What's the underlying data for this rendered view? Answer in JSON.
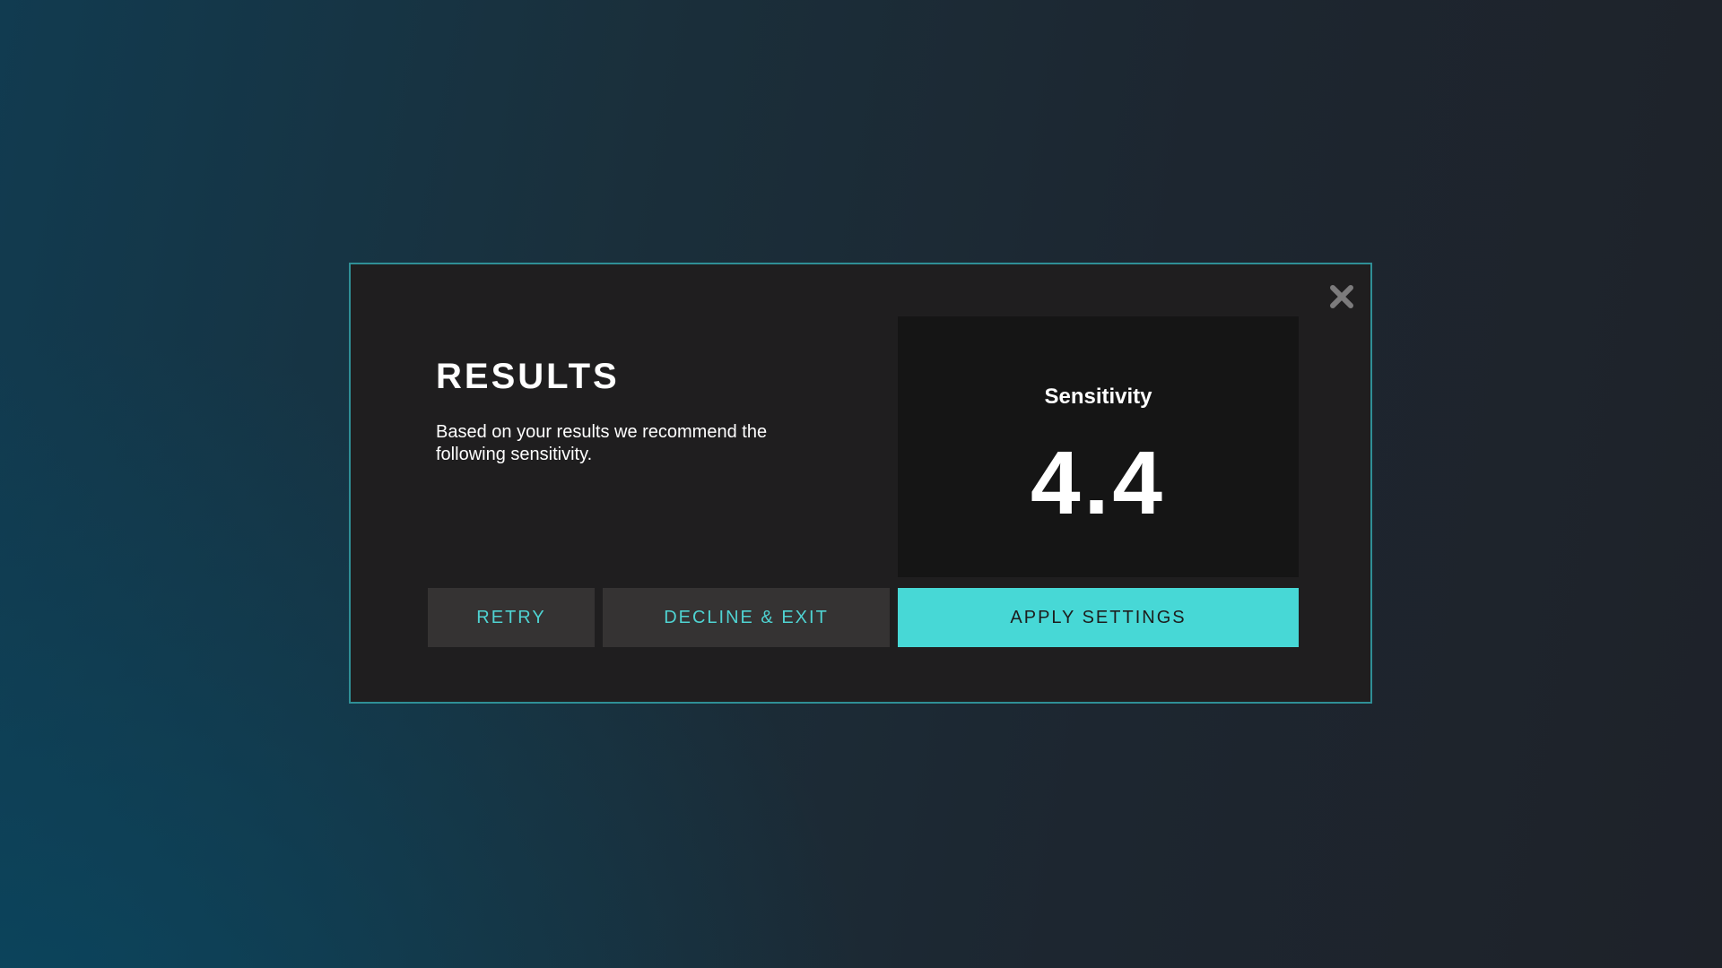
{
  "dialog": {
    "title": "RESULTS",
    "description": "Based on your results we recommend the following sensitivity.",
    "close_icon": "close-icon",
    "sensitivity": {
      "label": "Sensitivity",
      "value": "4.4"
    },
    "buttons": {
      "retry": "RETRY",
      "decline": "DECLINE & EXIT",
      "apply": "APPLY SETTINGS"
    }
  },
  "colors": {
    "accent": "#47d8d6",
    "accent_text": "#4fd3d2",
    "dialog_background": "#1f1e1f",
    "panel_background": "#151515",
    "secondary_button": "#353333",
    "border": "#2f8f96"
  }
}
